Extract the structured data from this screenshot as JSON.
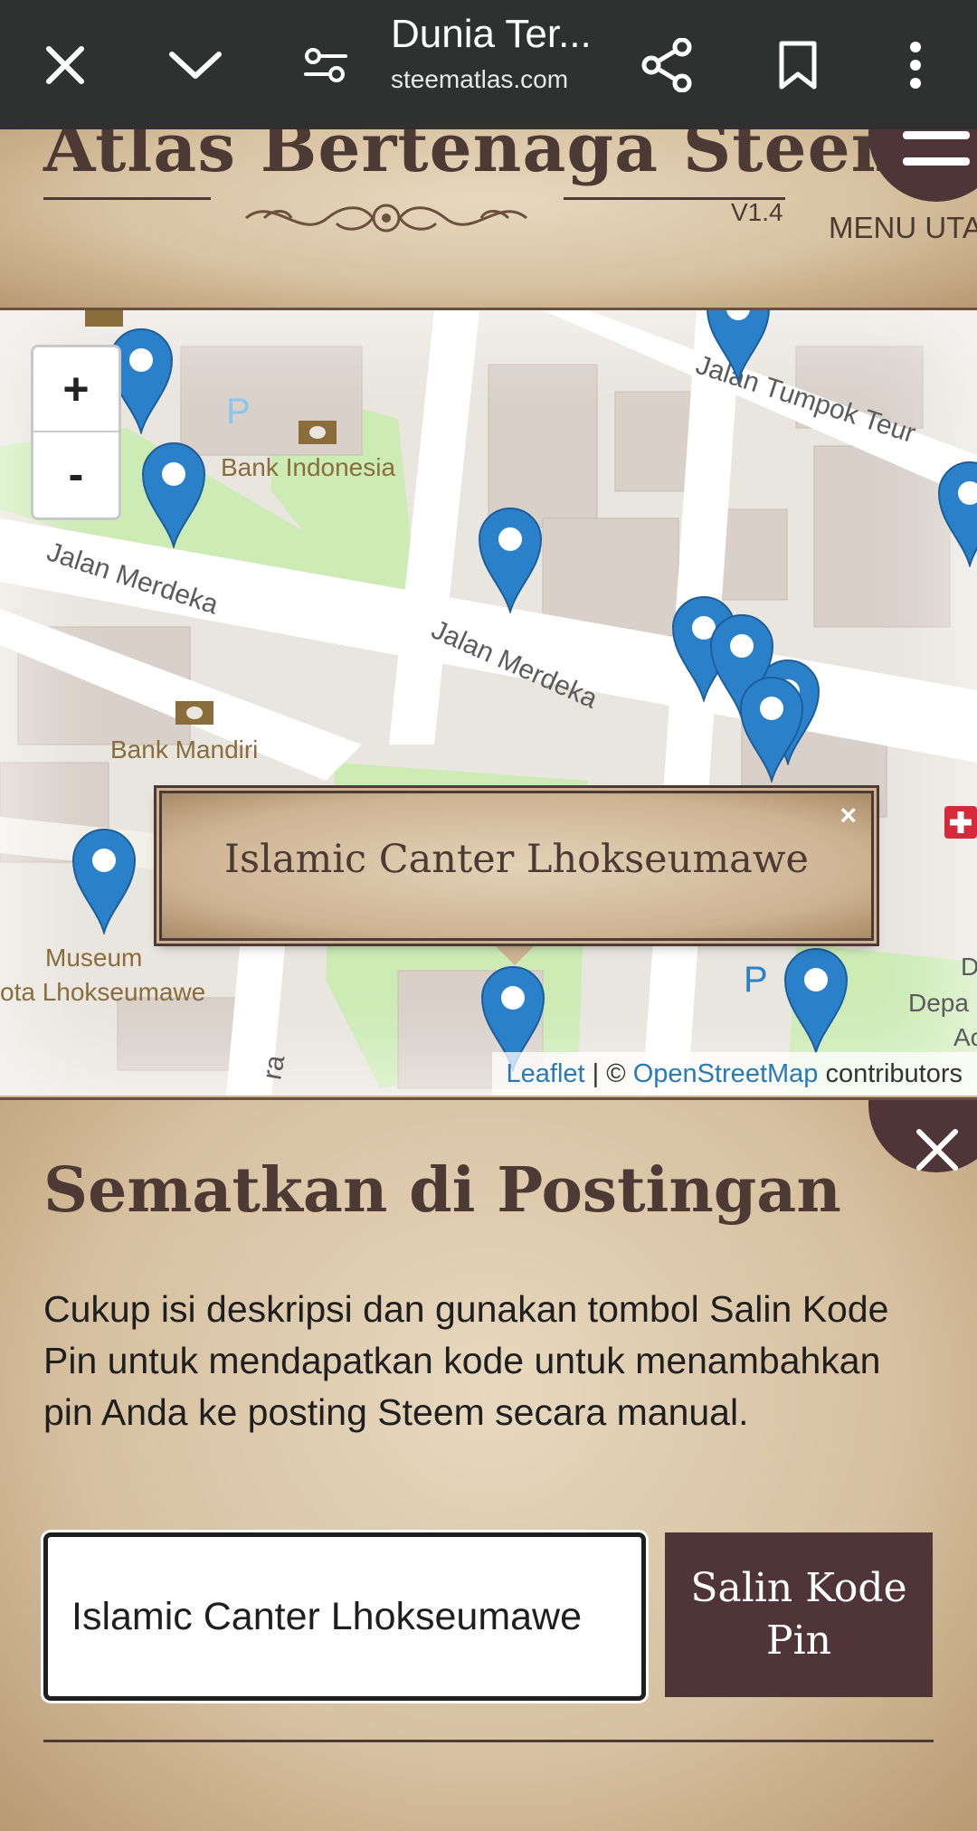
{
  "browser": {
    "title": "Dunia Ter...",
    "url": "steematlas.com"
  },
  "header": {
    "logo": "Atlas Bertenaga Steem",
    "version": "V1.4",
    "menu_label": "MENU UTA"
  },
  "map": {
    "zoom_in": "+",
    "zoom_out": "-",
    "labels": {
      "bank_indonesia": "Bank Indonesia",
      "bank_mandiri": "Bank Mandiri",
      "jalan_merdeka_1": "Jalan Merdeka",
      "jalan_merdeka_2": "Jalan Merdeka",
      "jalan_tumpok": "Jalan Tumpok Teur",
      "museum_1": "Museum",
      "museum_2": "ota Lhokseumawe",
      "depa_1": "D",
      "depa_2": "Depa",
      "depa_3": "Ac",
      "parking": "P",
      "road_ra": "ra"
    },
    "popup": {
      "text": "Islamic Canter Lhokseumawe",
      "close": "×"
    },
    "attribution": {
      "leaflet": "Leaflet",
      "sep": " | © ",
      "osm": "OpenStreetMap",
      "contrib": " contributors"
    }
  },
  "panel": {
    "title": "Sematkan di Postingan",
    "description": "Cukup isi deskripsi dan gunakan tombol Salin Kode Pin untuk mendapatkan kode untuk menambahkan pin Anda ke posting Steem secara manual.",
    "input_value": "Islamic Canter Lhokseumawe",
    "copy_button": "Salin Kode Pin"
  },
  "colors": {
    "brand_dark": "#4f3537",
    "marker_blue": "#2a80c9",
    "topbar": "#2f3030"
  }
}
